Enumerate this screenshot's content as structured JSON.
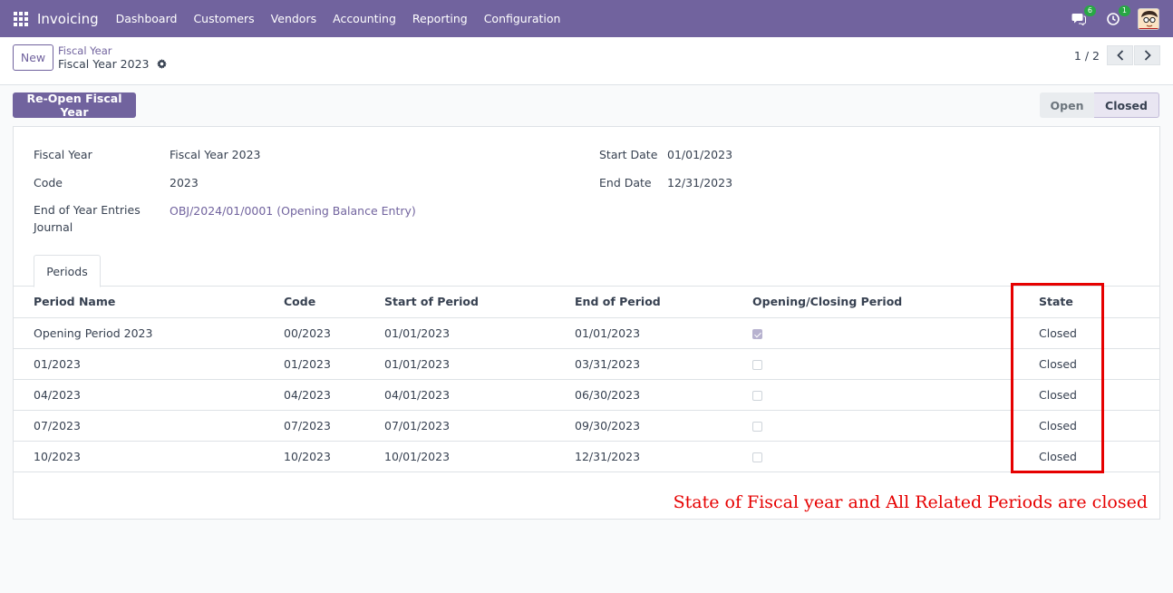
{
  "navbar": {
    "app_name": "Invoicing",
    "menu": [
      "Dashboard",
      "Customers",
      "Vendors",
      "Accounting",
      "Reporting",
      "Configuration"
    ],
    "messages_badge": "6",
    "activity_badge": "1",
    "bg_color": "#71639e"
  },
  "control_panel": {
    "new_label": "New",
    "breadcrumb": "Fiscal Year",
    "record_title": "Fiscal Year 2023",
    "pager_value": "1 / 2"
  },
  "action_bar": {
    "reopen_label": "Re-Open Fiscal Year",
    "status": {
      "open": "Open",
      "closed": "Closed",
      "current": "Closed"
    }
  },
  "form": {
    "fiscal_year_label": "Fiscal Year",
    "fiscal_year_value": "Fiscal Year 2023",
    "code_label": "Code",
    "code_value": "2023",
    "journal_label_line1": "End of Year Entries",
    "journal_label_line2": "Journal",
    "journal_value": "OBJ/2024/01/0001 (Opening Balance Entry)",
    "start_date_label": "Start Date",
    "start_date_value": "01/01/2023",
    "end_date_label": "End Date",
    "end_date_value": "12/31/2023"
  },
  "tabs": {
    "periods": "Periods"
  },
  "periods_table": {
    "headers": [
      "Period Name",
      "Code",
      "Start of Period",
      "End of Period",
      "Opening/Closing Period",
      "State"
    ],
    "rows": [
      {
        "name": "Opening Period 2023",
        "code": "00/2023",
        "start": "01/01/2023",
        "end": "01/01/2023",
        "opening": true,
        "state": "Closed"
      },
      {
        "name": "01/2023",
        "code": "01/2023",
        "start": "01/01/2023",
        "end": "03/31/2023",
        "opening": false,
        "state": "Closed"
      },
      {
        "name": "04/2023",
        "code": "04/2023",
        "start": "04/01/2023",
        "end": "06/30/2023",
        "opening": false,
        "state": "Closed"
      },
      {
        "name": "07/2023",
        "code": "07/2023",
        "start": "07/01/2023",
        "end": "09/30/2023",
        "opening": false,
        "state": "Closed"
      },
      {
        "name": "10/2023",
        "code": "10/2023",
        "start": "10/01/2023",
        "end": "12/31/2023",
        "opening": false,
        "state": "Closed"
      }
    ]
  },
  "annotation": {
    "text": "State of Fiscal year and All Related Periods are closed",
    "color": "#e60000"
  }
}
